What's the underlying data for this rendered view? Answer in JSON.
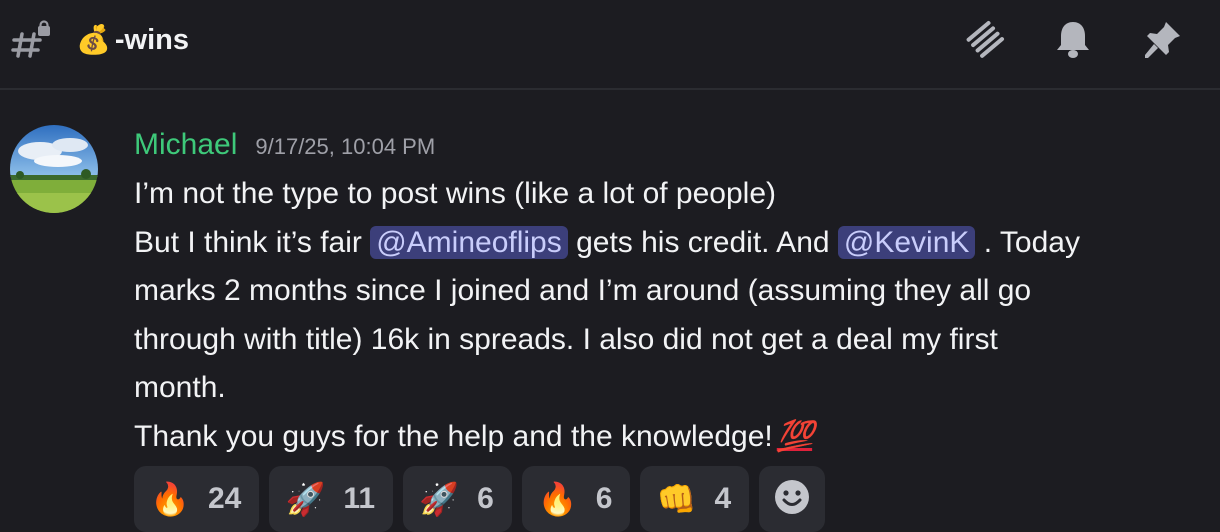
{
  "header": {
    "channel_emoji": "💰",
    "channel_name": "-wins",
    "buttons": [
      "threads-icon",
      "bell-icon",
      "pin-icon"
    ]
  },
  "message": {
    "author": "Michael",
    "timestamp": "9/17/25, 10:04 PM",
    "line1": "I’m not the type to post wins (like a lot of people)",
    "line2_a": "But I think it’s fair ",
    "mention1": "@Amineoflips",
    "line2_b": " gets his credit. And ",
    "mention2": "@KevinK",
    "line2_c": " . Today",
    "line3": "marks 2 months since I joined and I’m around (assuming they all go",
    "line4": "through with title) 16k in spreads. I also did not get a deal my first",
    "line5": "month.",
    "line6": "Thank you guys for the help and the knowledge!",
    "line6_emoji": "💯"
  },
  "reactions": [
    {
      "emoji": "🔥",
      "count": "24"
    },
    {
      "emoji": "🚀",
      "count": "11"
    },
    {
      "emoji": "🚀",
      "count": "6"
    },
    {
      "emoji": "🔥",
      "count": "6"
    },
    {
      "emoji": "👊",
      "count": "4"
    }
  ],
  "colors": {
    "background": "#1c1c21",
    "author": "#3ec97a",
    "mention_bg": "#3c3f7a",
    "mention_text": "#c9cdfb"
  }
}
